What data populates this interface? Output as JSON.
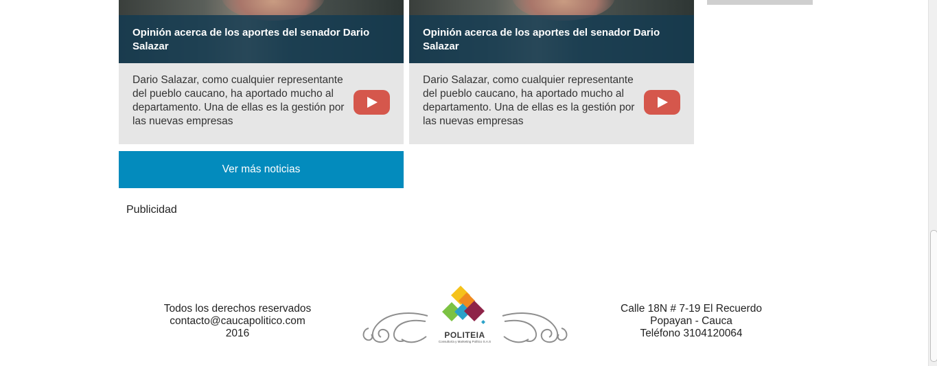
{
  "news_cards": [
    {
      "title": "Opinión acerca de los aportes del senador Dario Salazar",
      "description": "Dario Salazar, como cualquier representante del pueblo caucano, ha aportado mucho al departamento. Una de ellas es la gestión por las nuevas empresas"
    },
    {
      "title": "Opinión acerca de los aportes del senador Dario Salazar",
      "description": "Dario Salazar, como cualquier representante del pueblo caucano, ha aportado mucho al departamento. Una de ellas es la gestión por las nuevas empresas"
    }
  ],
  "more_news_label": "Ver más noticias",
  "ads_label": "Publicidad",
  "footer": {
    "left": {
      "rights": "Todos los derechos reservados",
      "email": "contacto@caucapolitico.com",
      "year": "2016"
    },
    "logo": {
      "name": "POLITEIA",
      "tagline": "Consultoría y Marketing Político S.A.S"
    },
    "right": {
      "address": "Calle 18N # 7-19 El Recuerdo",
      "city": "Popayan - Cauca",
      "phone": "Teléfono 3104120064"
    }
  },
  "colors": {
    "accent": "#038bbd",
    "card_bg": "#e6e6e6",
    "play_button": "#d5574c",
    "title_overlay": "#123a52"
  },
  "icons": [
    "youtube-play-icon",
    "politeia-logo",
    "ornament-swirl-left",
    "ornament-swirl-right"
  ]
}
